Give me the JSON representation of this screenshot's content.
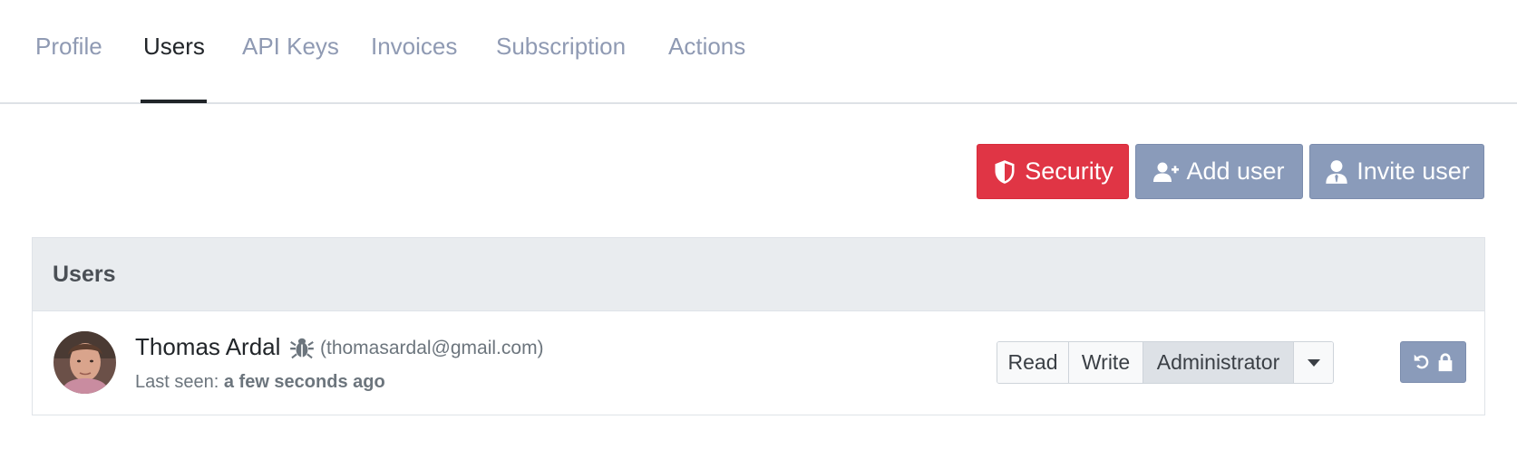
{
  "tabs": [
    {
      "label": "Profile",
      "active": false
    },
    {
      "label": "Users",
      "active": true
    },
    {
      "label": "API Keys",
      "active": false
    },
    {
      "label": "Invoices",
      "active": false
    },
    {
      "label": "Subscription",
      "active": false
    },
    {
      "label": "Actions",
      "active": false
    }
  ],
  "toolbar": {
    "security_label": "Security",
    "add_user_label": "Add user",
    "invite_user_label": "Invite user",
    "colors": {
      "security": "#e03545",
      "secondary": "#8a9bba"
    }
  },
  "users_card": {
    "title": "Users",
    "users": [
      {
        "name": "Thomas Ardal",
        "email": "(thomasardal@gmail.com)",
        "last_seen_label": "Last seen:",
        "last_seen_value": "a few seconds ago",
        "icon": "bug-icon",
        "roles": [
          "Read",
          "Write",
          "Administrator"
        ],
        "selected_role": "Administrator",
        "reset_icons": [
          "undo-icon",
          "lock-icon"
        ]
      }
    ]
  }
}
